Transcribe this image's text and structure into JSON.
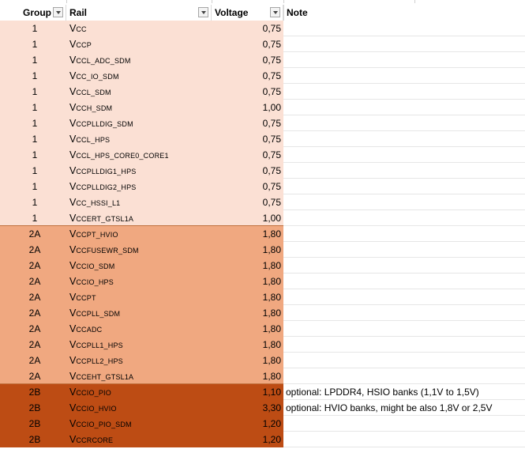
{
  "headers": {
    "group": "Group",
    "rail": "Rail",
    "voltage": "Voltage",
    "note": "Note"
  },
  "colors": {
    "group_1": "#fbe0d4",
    "group_2A": "#f0a880",
    "group_2B": "#bd4c14",
    "group_2B_text": "#ffffff"
  },
  "rows": [
    {
      "group": "1",
      "rail_prefix": "V",
      "rail_sub": "CC",
      "voltage": "0,75",
      "note": ""
    },
    {
      "group": "1",
      "rail_prefix": "V",
      "rail_sub": "CCP",
      "voltage": "0,75",
      "note": ""
    },
    {
      "group": "1",
      "rail_prefix": "V",
      "rail_sub": "CCL_ADC_SDM",
      "voltage": "0,75",
      "note": ""
    },
    {
      "group": "1",
      "rail_prefix": "V",
      "rail_sub": "CC_IO_SDM",
      "voltage": "0,75",
      "note": ""
    },
    {
      "group": "1",
      "rail_prefix": "V",
      "rail_sub": "CCL_SDM",
      "voltage": "0,75",
      "note": ""
    },
    {
      "group": "1",
      "rail_prefix": "V",
      "rail_sub": "CCH_SDM",
      "voltage": "1,00",
      "note": ""
    },
    {
      "group": "1",
      "rail_prefix": "V",
      "rail_sub": "CCPLLDIG_SDM",
      "voltage": "0,75",
      "note": ""
    },
    {
      "group": "1",
      "rail_prefix": "V",
      "rail_sub": "CCL_HPS",
      "voltage": "0,75",
      "note": ""
    },
    {
      "group": "1",
      "rail_prefix": "V",
      "rail_sub": "CCL_HPS_CORE0_CORE1",
      "voltage": "0,75",
      "note": ""
    },
    {
      "group": "1",
      "rail_prefix": "V",
      "rail_sub": "CCPLLDIG1_HPS",
      "voltage": "0,75",
      "note": ""
    },
    {
      "group": "1",
      "rail_prefix": "V",
      "rail_sub": "CCPLLDIG2_HPS",
      "voltage": "0,75",
      "note": ""
    },
    {
      "group": "1",
      "rail_prefix": "V",
      "rail_sub": "CC_HSSI_L1",
      "voltage": "0,75",
      "note": ""
    },
    {
      "group": "1",
      "rail_prefix": "V",
      "rail_sub": "CCERT_GTSL1A",
      "voltage": "1,00",
      "note": ""
    },
    {
      "group": "2A",
      "rail_prefix": "V",
      "rail_sub": "CCPT_HVIO",
      "voltage": "1,80",
      "note": ""
    },
    {
      "group": "2A",
      "rail_prefix": "V",
      "rail_sub": "CCFUSEWR_SDM",
      "voltage": "1,80",
      "note": ""
    },
    {
      "group": "2A",
      "rail_prefix": "V",
      "rail_sub": "CCIO_SDM",
      "voltage": "1,80",
      "note": ""
    },
    {
      "group": "2A",
      "rail_prefix": "V",
      "rail_sub": "CCIO_HPS",
      "voltage": "1,80",
      "note": ""
    },
    {
      "group": "2A",
      "rail_prefix": "V",
      "rail_sub": "CCPT",
      "voltage": "1,80",
      "note": ""
    },
    {
      "group": "2A",
      "rail_prefix": "V",
      "rail_sub": "CCPLL_SDM",
      "voltage": "1,80",
      "note": ""
    },
    {
      "group": "2A",
      "rail_prefix": "V",
      "rail_sub": "CCADC",
      "voltage": "1,80",
      "note": ""
    },
    {
      "group": "2A",
      "rail_prefix": "V",
      "rail_sub": "CCPLL1_HPS",
      "voltage": "1,80",
      "note": ""
    },
    {
      "group": "2A",
      "rail_prefix": "V",
      "rail_sub": "CCPLL2_HPS",
      "voltage": "1,80",
      "note": ""
    },
    {
      "group": "2A",
      "rail_prefix": "V",
      "rail_sub": "CCEHT_GTSL1A",
      "voltage": "1,80",
      "note": ""
    },
    {
      "group": "2B",
      "rail_prefix": "V",
      "rail_sub": "CCIO_PIO",
      "voltage": "1,10",
      "note": "optional: LPDDR4, HSIO banks (1,1V to 1,5V)"
    },
    {
      "group": "2B",
      "rail_prefix": "V",
      "rail_sub": "CCIO_HVIO",
      "voltage": "3,30",
      "note": "optional: HVIO banks, might be also 1,8V or 2,5V"
    },
    {
      "group": "2B",
      "rail_prefix": "V",
      "rail_sub": "CCIO_PIO_SDM",
      "voltage": "1,20",
      "note": ""
    },
    {
      "group": "2B",
      "rail_prefix": "V",
      "rail_sub": "CCRCORE",
      "voltage": "1,20",
      "note": ""
    }
  ]
}
